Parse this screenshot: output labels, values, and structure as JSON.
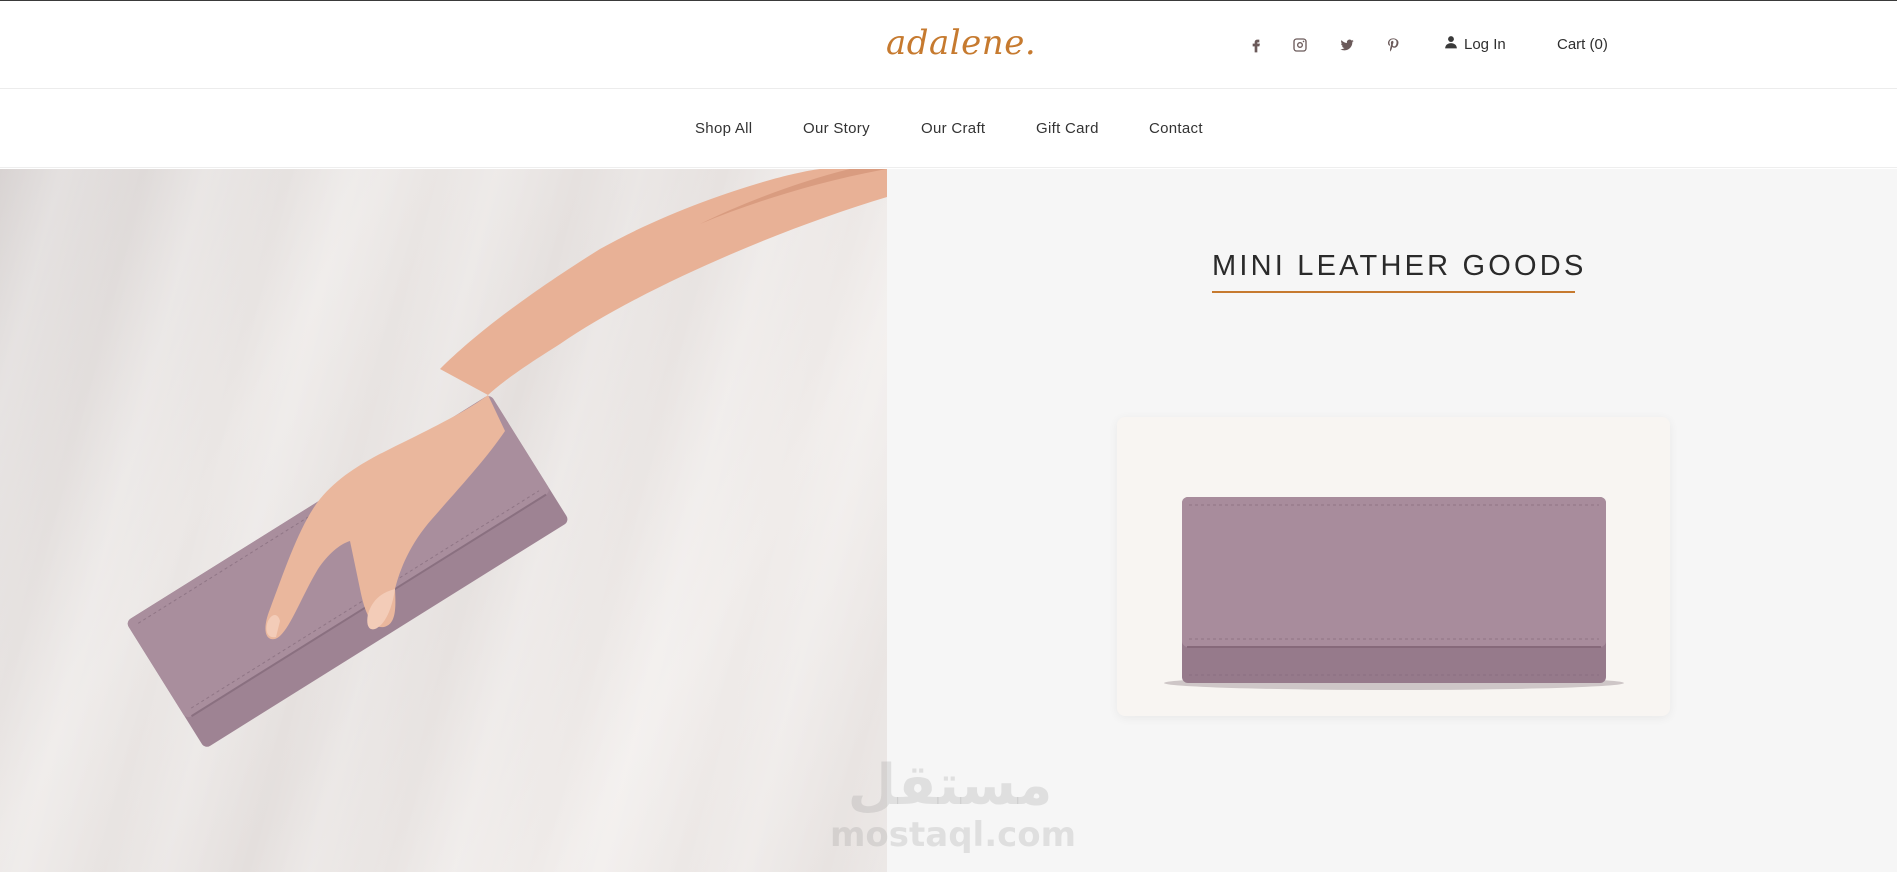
{
  "header": {
    "logo": "adalene.",
    "social_icons": [
      "facebook-icon",
      "instagram-icon",
      "twitter-icon",
      "pinterest-icon"
    ],
    "login_label": "Log In",
    "cart_label": "Cart (0)"
  },
  "nav": {
    "items": [
      "Shop All",
      "Our Story",
      "Our Craft",
      "Gift Card",
      "Contact"
    ]
  },
  "hero": {
    "section_title": "MINI LEATHER GOODS"
  },
  "watermark": {
    "arabic": "مستقل",
    "latin": "mostaql.com"
  },
  "colors": {
    "accent": "#c67a2f",
    "wallet": "#9a7f91",
    "panel_bg": "#f6f6f6"
  }
}
